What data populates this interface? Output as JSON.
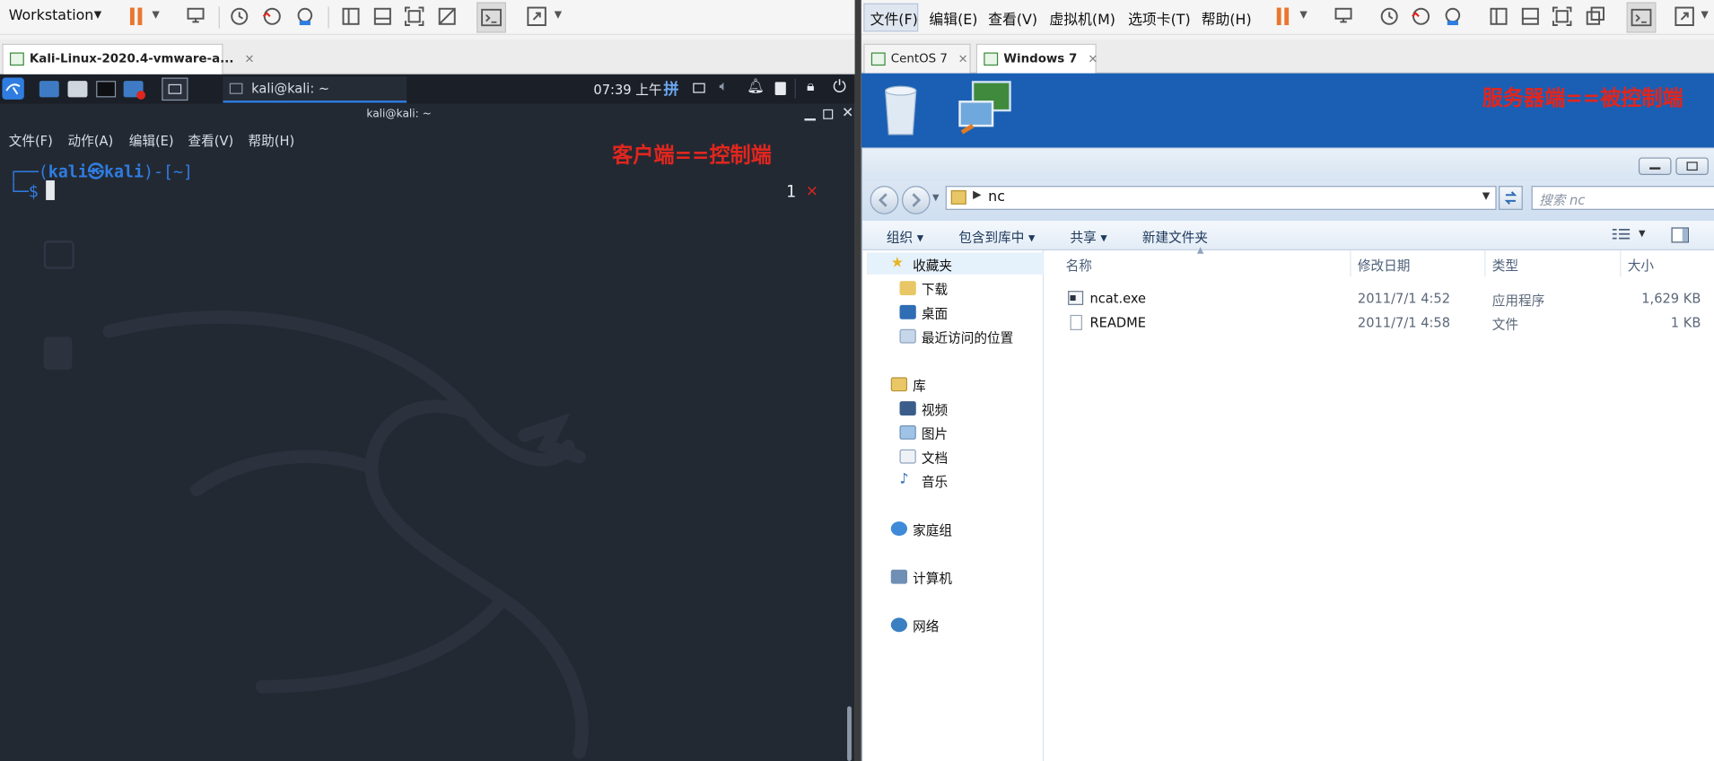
{
  "left_vm": {
    "workstation_label": "Workstation",
    "tab_label": "Kali-Linux-2020.4-vmware-a...",
    "tab_close": "×",
    "panel": {
      "task_label": "kali@kali: ~",
      "clock": "07:39 上午",
      "ime": "拼"
    },
    "window_title": "kali@kali: ~",
    "menu": [
      "文件(F)",
      "动作(A)",
      "编辑(E)",
      "查看(V)",
      "帮助(H)"
    ],
    "prompt_line1_prefix": "┌──(",
    "prompt_user": "kali㉿kali",
    "prompt_line1_suffix": ")-[~]",
    "prompt_line2": "└─$",
    "job_count": "1",
    "job_status": "×",
    "annotation": "客户端==控制端"
  },
  "right_vm": {
    "menu": [
      "文件(F)",
      "编辑(E)",
      "查看(V)",
      "虚拟机(M)",
      "选项卡(T)",
      "帮助(H)"
    ],
    "tabs": [
      {
        "label": "CentOS 7",
        "close": "×",
        "active": false
      },
      {
        "label": "Windows 7",
        "close": "×",
        "active": true
      }
    ],
    "annotation": "服务器端==被控制端",
    "explorer": {
      "address_path": "nc",
      "search_placeholder": "搜索 nc",
      "commands": [
        "组织 ▾",
        "包含到库中 ▾",
        "共享 ▾",
        "新建文件夹"
      ],
      "nav": {
        "favorites": "收藏夹",
        "favorites_items": [
          "下载",
          "桌面",
          "最近访问的位置"
        ],
        "library": "库",
        "library_items": [
          "视频",
          "图片",
          "文档",
          "音乐"
        ],
        "homegroup": "家庭组",
        "computer": "计算机",
        "network": "网络"
      },
      "columns": [
        "名称",
        "修改日期",
        "类型",
        "大小"
      ],
      "files": [
        {
          "name": "ncat.exe",
          "date": "2011/7/1 4:52",
          "type": "应用程序",
          "size": "1,629 KB",
          "icon": "exe-icon"
        },
        {
          "name": "README",
          "date": "2011/7/1 4:58",
          "type": "文件",
          "size": "1 KB",
          "icon": "file-icon"
        }
      ]
    }
  },
  "colors": {
    "kali_bg": "#232933",
    "kali_prompt": "#2f7de1",
    "annotation_red": "#e0261e",
    "vmware_pause": "#e8772e",
    "win7_desktop": "#1a5fb4"
  }
}
